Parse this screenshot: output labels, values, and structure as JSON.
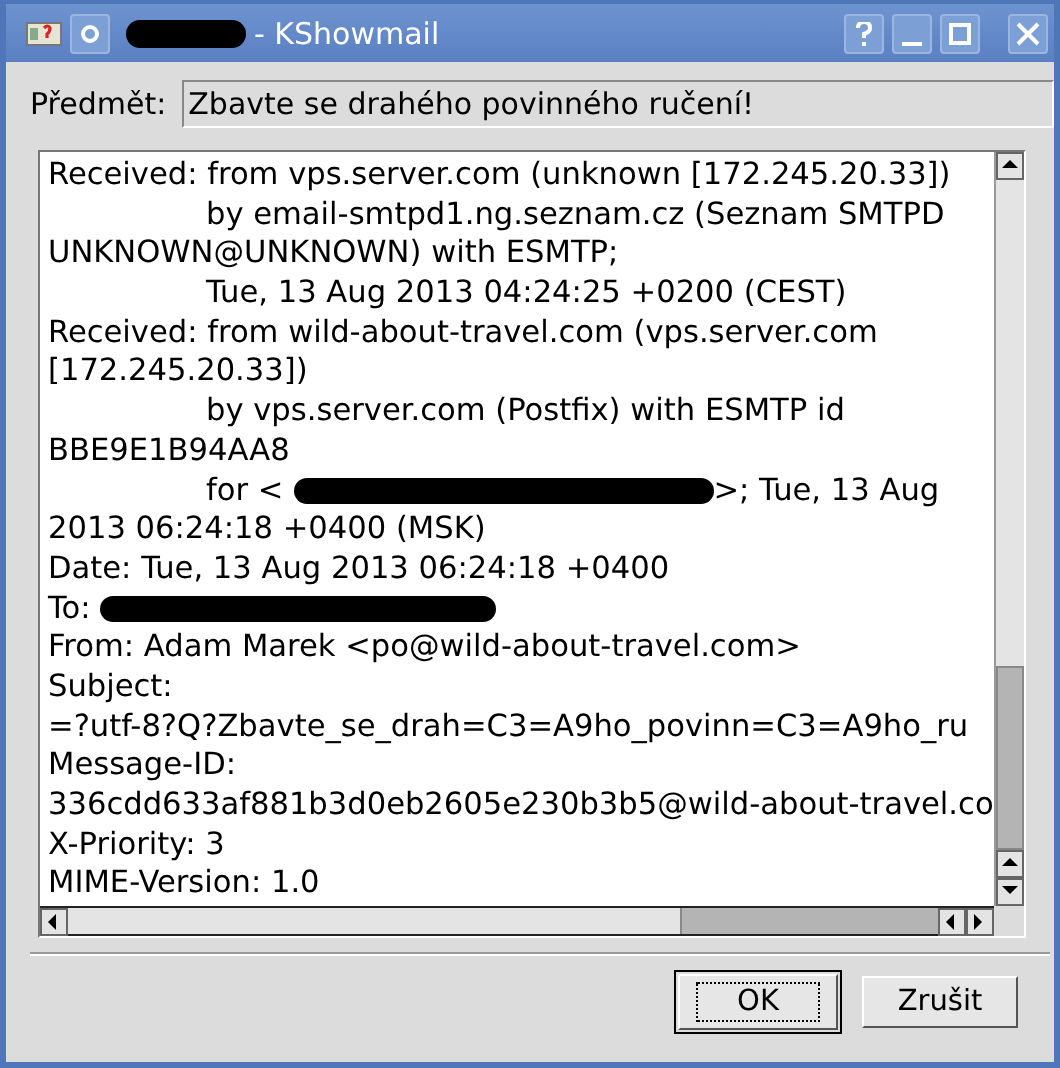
{
  "window": {
    "title": "- KShowmail"
  },
  "subject": {
    "label": "Předmět:",
    "value": "Zbavte se drahého povinného ručení!"
  },
  "header_lines": [
    {
      "indent": false,
      "parts": [
        {
          "kind": "text",
          "text": "Received: from vps.server.com (unknown [172.245.20.33])"
        }
      ]
    },
    {
      "indent": true,
      "parts": [
        {
          "kind": "text",
          "text": "by email-smtpd1.ng.seznam.cz (Seznam SMTPD"
        }
      ]
    },
    {
      "indent": false,
      "parts": [
        {
          "kind": "text",
          "text": "UNKNOWN@UNKNOWN) with ESMTP;"
        }
      ]
    },
    {
      "indent": true,
      "parts": [
        {
          "kind": "text",
          "text": "Tue, 13 Aug 2013 04:24:25 +0200 (CEST)"
        }
      ]
    },
    {
      "indent": false,
      "parts": [
        {
          "kind": "text",
          "text": "Received: from wild-about-travel.com (vps.server.com"
        }
      ]
    },
    {
      "indent": false,
      "parts": [
        {
          "kind": "text",
          "text": "[172.245.20.33])"
        }
      ]
    },
    {
      "indent": true,
      "parts": [
        {
          "kind": "text",
          "text": "by vps.server.com (Postfix) with ESMTP id"
        }
      ]
    },
    {
      "indent": false,
      "parts": [
        {
          "kind": "text",
          "text": "BBE9E1B94AA8"
        }
      ]
    },
    {
      "indent": true,
      "parts": [
        {
          "kind": "text",
          "text": "for <"
        },
        {
          "kind": "redaction"
        },
        {
          "kind": "text",
          "text": ">; Tue, 13 Aug"
        }
      ]
    },
    {
      "indent": false,
      "parts": [
        {
          "kind": "text",
          "text": "2013 06:24:18 +0400 (MSK)"
        }
      ]
    },
    {
      "indent": false,
      "parts": [
        {
          "kind": "text",
          "text": "Date: Tue, 13 Aug 2013 06:24:18 +0400"
        }
      ]
    },
    {
      "indent": false,
      "parts": [
        {
          "kind": "text",
          "text": "To:"
        },
        {
          "kind": "redaction"
        }
      ]
    },
    {
      "indent": false,
      "parts": [
        {
          "kind": "text",
          "text": "From: Adam Marek <po@wild-about-travel.com>"
        }
      ]
    },
    {
      "indent": false,
      "parts": [
        {
          "kind": "text",
          "text": "Subject:"
        }
      ]
    },
    {
      "indent": false,
      "parts": [
        {
          "kind": "text",
          "text": "=?utf-8?Q?Zbavte_se_drah=C3=A9ho_povinn=C3=A9ho_ru"
        }
      ]
    },
    {
      "indent": false,
      "parts": [
        {
          "kind": "text",
          "text": "Message-ID:"
        }
      ]
    },
    {
      "indent": false,
      "parts": [
        {
          "kind": "text",
          "text": "336cdd633af881b3d0eb2605e230b3b5@wild-about-travel.co"
        }
      ]
    },
    {
      "indent": false,
      "parts": [
        {
          "kind": "text",
          "text": "X-Priority: 3"
        }
      ]
    },
    {
      "indent": false,
      "parts": [
        {
          "kind": "text",
          "text": "MIME-Version: 1.0"
        }
      ]
    }
  ],
  "buttons": [
    {
      "label": "OK",
      "default": true
    },
    {
      "label": "Zrušit",
      "default": false
    }
  ]
}
